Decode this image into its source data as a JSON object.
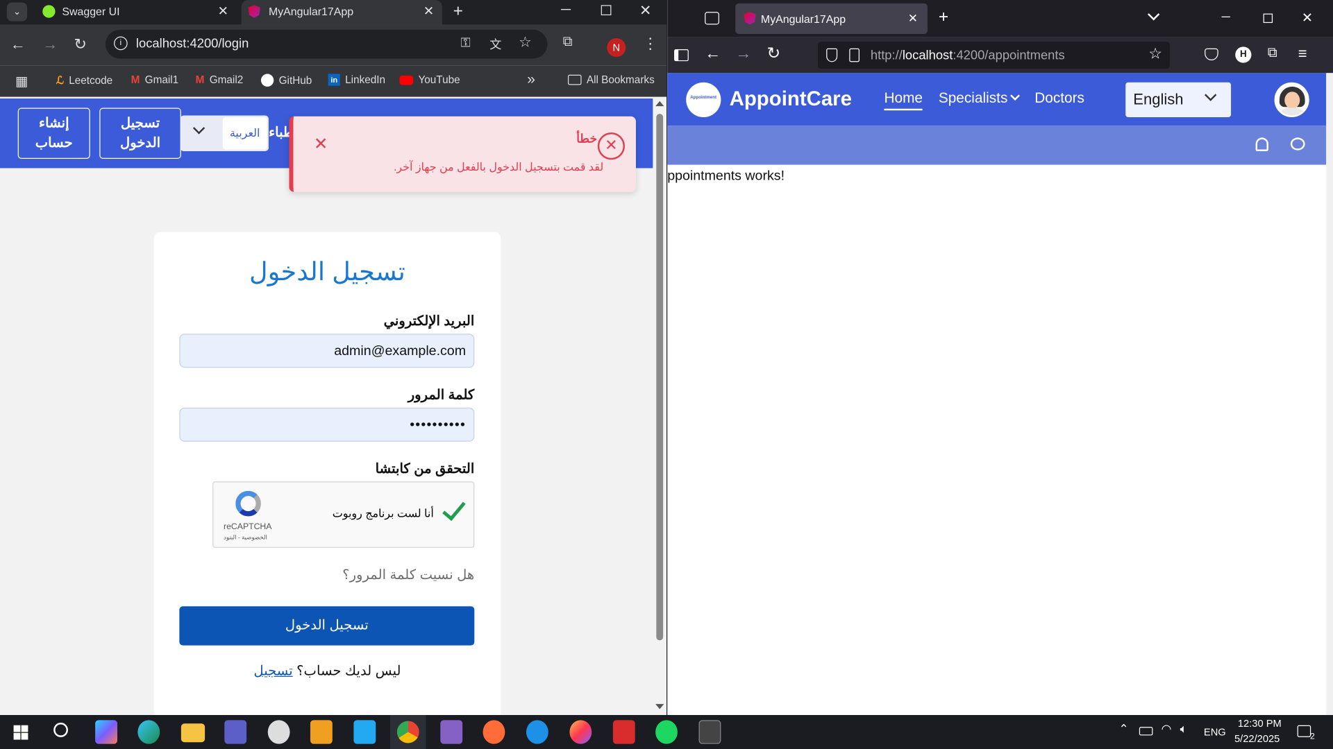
{
  "chrome": {
    "tabs": [
      {
        "title": "Swagger UI"
      },
      {
        "title": "MyAngular17App"
      }
    ],
    "new_tab": "+",
    "url": "localhost:4200/login",
    "profile_initial": "N",
    "bookmarks": [
      "Leetcode",
      "Gmail1",
      "Gmail2",
      "GitHub",
      "LinkedIn",
      "YouTube"
    ],
    "bookmarks_more": "»",
    "all_bookmarks": "All Bookmarks",
    "nav": {
      "create_account": "إنشاء حساب",
      "login": "تسجيل الدخول",
      "language_select": "العربية",
      "partial_text": "طباء"
    },
    "toast": {
      "title": "خطأ",
      "message": "لقد قمت بتسجيل الدخول بالفعل من جهاز آخر."
    },
    "form": {
      "title": "تسجيل الدخول",
      "email_label": "البريد الإلكتروني",
      "email_value": "admin@example.com",
      "password_label": "كلمة المرور",
      "password_value": "••••••••••",
      "captcha_label": "التحقق من كابتشا",
      "captcha_text": "أنا لست برنامج روبوت",
      "captcha_brand": "reCAPTCHA",
      "captcha_links": "الخصوصية - البنود",
      "forgot": "هل نسيت كلمة المرور؟",
      "submit": "تسجيل الدخول",
      "no_account": "ليس لديك حساب؟",
      "register": "تسجيل"
    }
  },
  "firefox": {
    "tab_title": "MyAngular17App",
    "url_prefix": "http://",
    "url_host": "localhost",
    "url_path": ":4200/appointments",
    "brand": "AppointCare",
    "logo_text": "Appointment",
    "nav": [
      "Home",
      "Specialists",
      "Doctors"
    ],
    "language": "English",
    "body_text": "ppointments works!"
  },
  "taskbar": {
    "language": "ENG",
    "time": "12:30 PM",
    "date": "5/22/2025",
    "notif_count": "2"
  },
  "colors": {
    "brand_blue": "#3b5bd8",
    "sub_blue": "#6a82d9",
    "submit_blue": "#0d55b5",
    "title_blue": "#1877d2",
    "error_red": "#e33e4f"
  }
}
